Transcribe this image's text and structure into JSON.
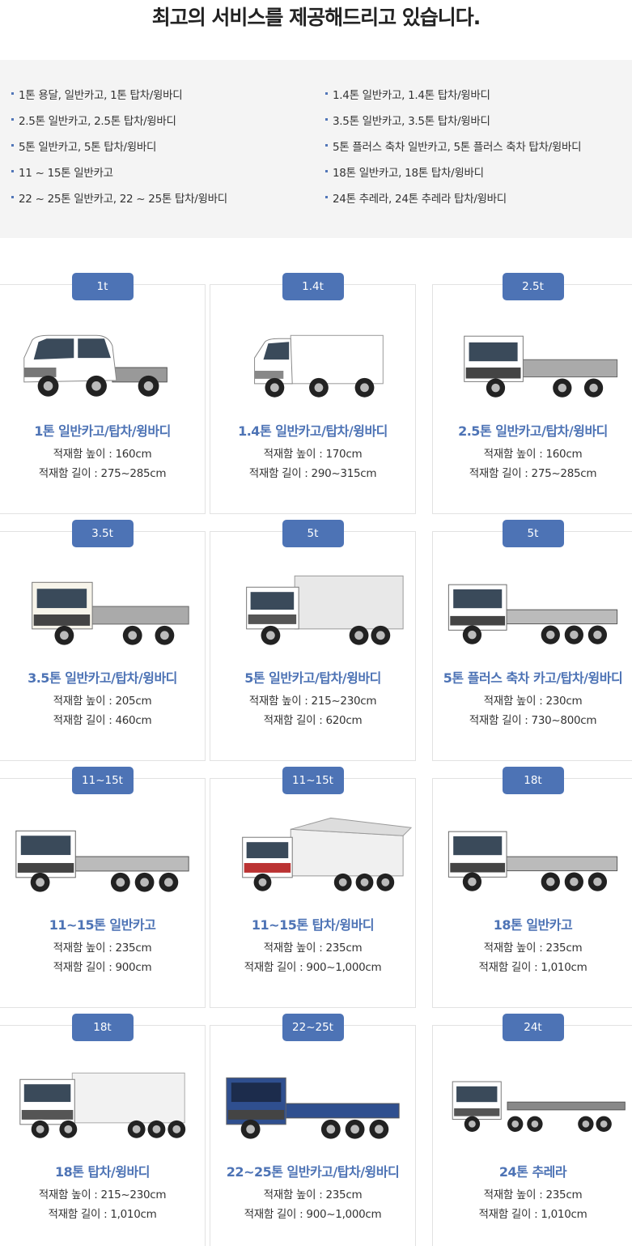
{
  "title": "최고의 서비스를 제공해드리고 있습니다.",
  "services": [
    "1톤 용달, 일반카고, 1톤 탑차/윙바디",
    "1.4톤 일반카고, 1.4톤 탑차/윙바디",
    "2.5톤 일반카고, 2.5톤 탑차/윙바디",
    "3.5톤 일반카고, 3.5톤 탑차/윙바디",
    "5톤 일반카고, 5톤 탑차/윙바디",
    "5톤 플러스 축차 일반카고, 5톤 플러스 축차 탑차/윙바디",
    "11 ~ 15톤 일반카고",
    "18톤 일반카고, 18톤 탑차/윙바디",
    "22 ~ 25톤 일반카고, 22 ~ 25톤 탑차/윙바디",
    "24톤 추레라, 24톤 추레라 탑차/윙바디"
  ],
  "vehicles": [
    {
      "badge": "1t",
      "name": "1톤 일반카고/탑차/윙바디",
      "height": "적재함 높이 : 160cm",
      "length": "적재함 길이 : 275~285cm",
      "type": "small-cargo",
      "cab": "#ffffff"
    },
    {
      "badge": "1.4t",
      "name": "1.4톤 일반카고/탑차/윙바디",
      "height": "적재함 높이 : 170cm",
      "length": "적재함 길이 : 290~315cm",
      "type": "small-box",
      "cab": "#ffffff"
    },
    {
      "badge": "2.5t",
      "name": "2.5톤 일반카고/탑차/윙바디",
      "height": "적재함 높이 : 160cm",
      "length": "적재함 길이 : 275~285cm",
      "type": "mid-cargo",
      "cab": "#ffffff"
    },
    {
      "badge": "3.5t",
      "name": "3.5톤 일반카고/탑차/윙바디",
      "height": "적재함 높이 : 205cm",
      "length": "적재함 길이 : 460cm",
      "type": "mid-cargo",
      "cab": "#f7f4ea"
    },
    {
      "badge": "5t",
      "name": "5톤 일반카고/탑차/윙바디",
      "height": "적재함 높이 : 215~230cm",
      "length": "적재함 길이 : 620cm",
      "type": "box",
      "cab": "#ffffff"
    },
    {
      "badge": "5t",
      "name": "5톤 플러스 축차 카고/탑차/윙바디",
      "height": "적재함 높이 : 230cm",
      "length": "적재함 길이 : 730~800cm",
      "type": "long-cargo",
      "cab": "#ffffff"
    },
    {
      "badge": "11~15t",
      "name": "11~15톤 일반카고",
      "height": "적재함 높이 : 235cm",
      "length": "적재함 길이 : 900cm",
      "type": "long-cargo",
      "cab": "#ffffff"
    },
    {
      "badge": "11~15t",
      "name": "11~15톤 탑차/윙바디",
      "height": "적재함 높이 : 235cm",
      "length": "적재함 길이 : 900~1,000cm",
      "type": "wing",
      "cab": "#ffffff"
    },
    {
      "badge": "18t",
      "name": "18톤 일반카고",
      "height": "적재함 높이 : 235cm",
      "length": "적재함 길이 : 1,010cm",
      "type": "long-cargo",
      "cab": "#ffffff"
    },
    {
      "badge": "18t",
      "name": "18톤 탑차/윙바디",
      "height": "적재함 높이 : 215~230cm",
      "length": "적재함 길이 : 1,010cm",
      "type": "box-long",
      "cab": "#ffffff"
    },
    {
      "badge": "22~25t",
      "name": "22~25톤 일반카고/탑차/윙바디",
      "height": "적재함 높이 : 235cm",
      "length": "적재함 길이 : 900~1,000cm",
      "type": "long-cargo",
      "cab": "#2f4f8f"
    },
    {
      "badge": "24t",
      "name": "24톤 추레라",
      "height": "적재함 높이 : 235cm",
      "length": "적재함 길이 : 1,010cm",
      "type": "trailer",
      "cab": "#ffffff"
    }
  ]
}
